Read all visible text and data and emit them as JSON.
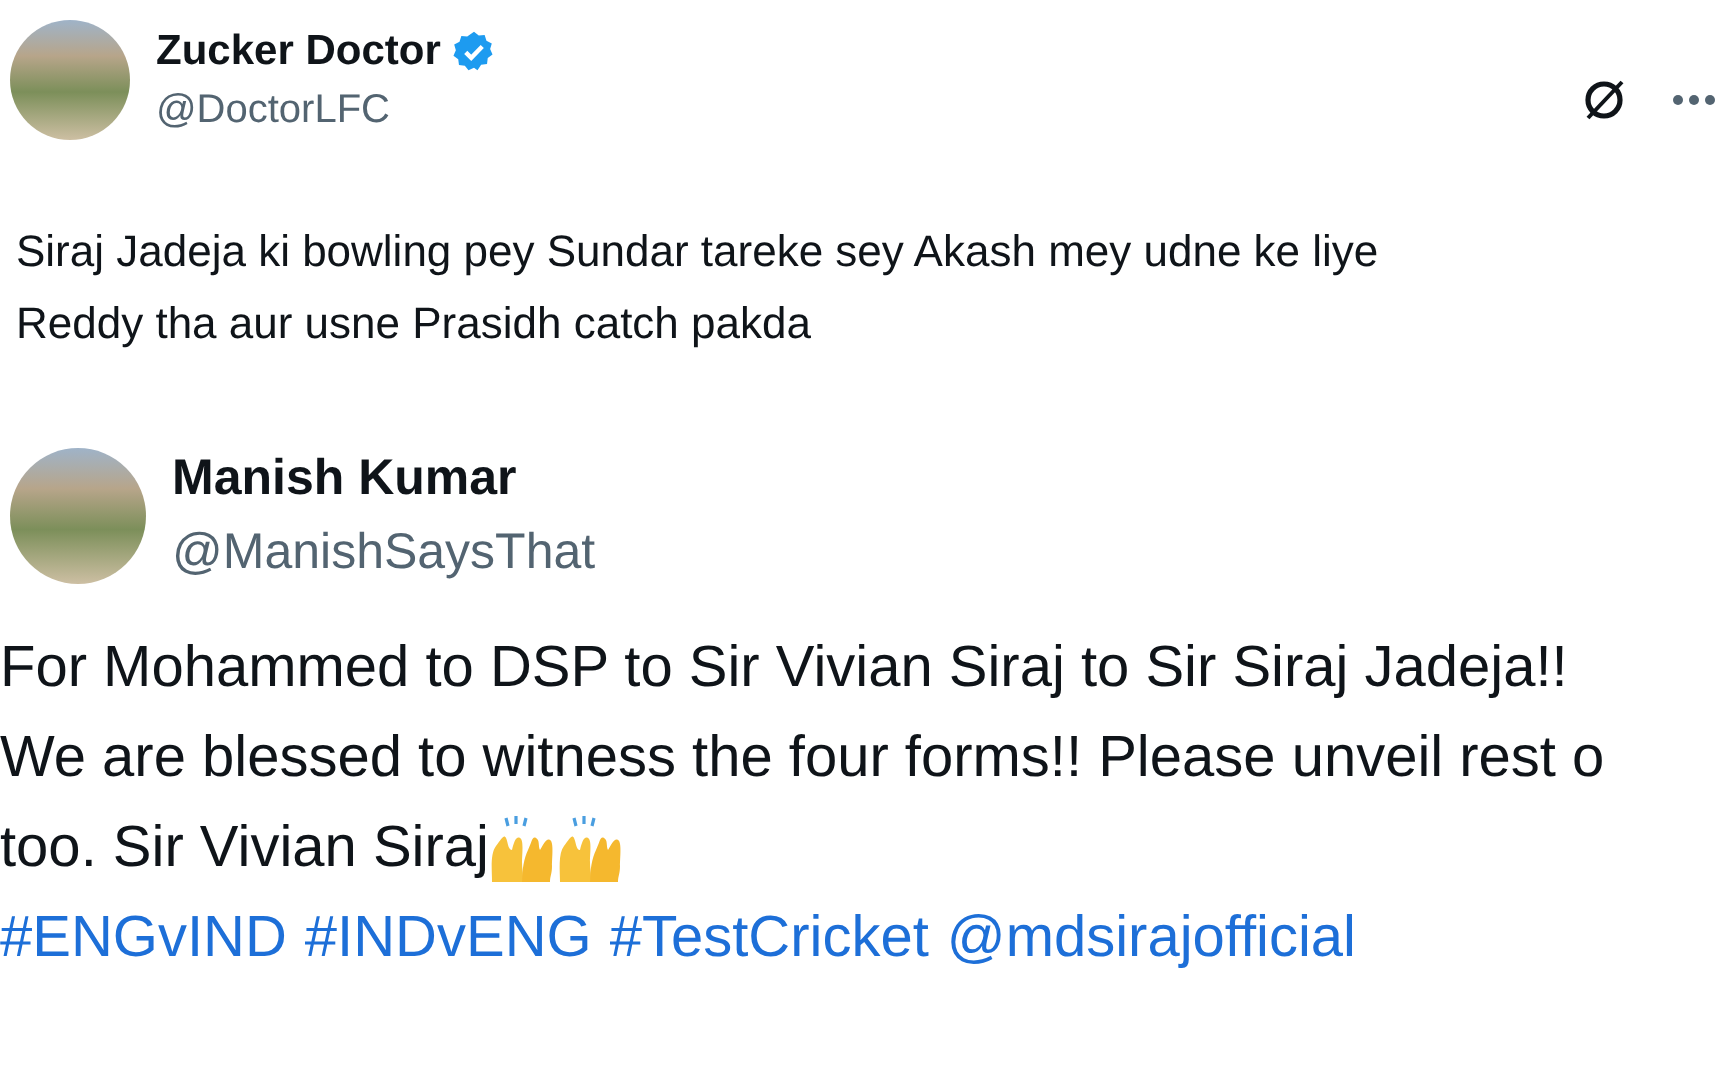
{
  "tweet": {
    "author": {
      "name": "Zucker Doctor",
      "handle": "@DoctorLFC",
      "verified": true
    },
    "text_lines": [
      "Siraj Jadeja ki bowling pey Sundar tareke sey Akash mey udne ke liye",
      "Reddy tha aur usne Prasidh catch pakda"
    ]
  },
  "quoted_tweet": {
    "author": {
      "name": "Manish Kumar",
      "handle": "@ManishSaysThat"
    },
    "text_lines": [
      "For Mohammed to DSP to Sir Vivian Siraj to Sir Siraj Jadeja!!",
      "We are blessed to witness the four forms!! Please unveil rest o",
      "too. Sir Vivian Siraj"
    ],
    "links": [
      "#ENGvIND",
      "#INDvENG",
      "#TestCricket",
      "@mdsirajofficial"
    ]
  }
}
